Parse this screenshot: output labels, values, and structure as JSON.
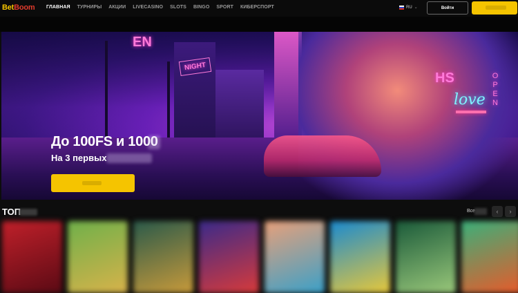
{
  "header": {
    "logo_part1": "Bet",
    "logo_part2": "Boom",
    "nav": [
      "ГЛАВНАЯ",
      "ТУРНИРЫ",
      "АКЦИИ",
      "LIVECASINO",
      "SLOTS",
      "BINGO",
      "SPORT",
      "КИБЕРСПОРТ"
    ],
    "active_nav": "ГЛАВНАЯ",
    "language": "RU",
    "login_label": "Войти"
  },
  "banner": {
    "title": "До 100FS и 1000",
    "subtitle": "На 3 первых",
    "slides": 3,
    "active_slide": 2
  },
  "top_section": {
    "title": "ТОП",
    "all_label": "Все",
    "prev_icon": "chevron-left-icon",
    "next_icon": "chevron-right-icon"
  },
  "game_tiles": [
    {
      "color_a": "#c0202a",
      "color_b": "#5a0a14"
    },
    {
      "color_a": "#6fb04a",
      "color_b": "#d8b24a"
    },
    {
      "color_a": "#2a5a4a",
      "color_b": "#c89a3a"
    },
    {
      "color_a": "#3a2a8a",
      "color_b": "#d83a3a"
    },
    {
      "color_a": "#e8a07a",
      "color_b": "#3aa0c8"
    },
    {
      "color_a": "#1a8ad0",
      "color_b": "#e8c83a"
    },
    {
      "color_a": "#1a5a3a",
      "color_b": "#9ac87a"
    },
    {
      "color_a": "#3ab07a",
      "color_b": "#e85a2a"
    }
  ],
  "colors": {
    "accent": "#f5c400",
    "brand_red": "#e03b2c",
    "background": "#0d0d0d"
  }
}
